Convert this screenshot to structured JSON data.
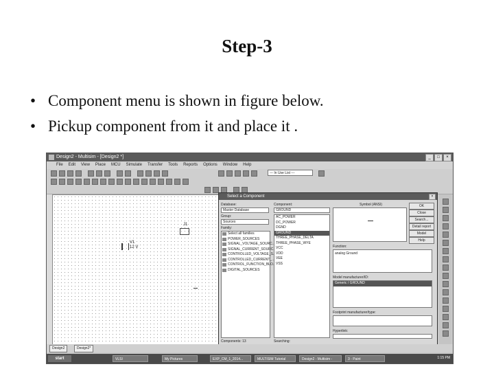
{
  "slide": {
    "title": "Step-3",
    "bullets": [
      "Component menu is shown in figure below.",
      "Pickup component from it and place it ."
    ]
  },
  "app": {
    "window_title": "Design2 - Multisim - [Design2 *]",
    "menus": [
      "File",
      "Edit",
      "View",
      "Place",
      "MCU",
      "Simulate",
      "Transfer",
      "Tools",
      "Reports",
      "Options",
      "Window",
      "Help"
    ],
    "in_use_list": "--- In Use List ---",
    "components": {
      "v1_name": "V1",
      "v1_value": "12 V",
      "j1_name": "J1"
    },
    "tabs": [
      "Design2",
      "Design2*"
    ]
  },
  "dialog": {
    "title": "Select a Component",
    "database_label": "Database:",
    "database_value": "Master Database",
    "group_label": "Group:",
    "group_value": "Sources",
    "family_label": "Family:",
    "families": [
      "Select all families",
      "POWER_SOURCES",
      "SIGNAL_VOLTAGE_SOURC...",
      "SIGNAL_CURRENT_SOURC...",
      "CONTROLLED_VOLTAGE_S...",
      "CONTROLLED_CURRENT_...",
      "CONTROL_FUNCTION_BLO...",
      "DIGITAL_SOURCES"
    ],
    "component_label": "Component:",
    "component_value": "GROUND",
    "component_list": [
      "AC_POWER",
      "DC_POWER",
      "DGND",
      "GROUND",
      "THREE_PHASE_DELTA",
      "THREE_PHASE_WYE",
      "VCC",
      "VDD",
      "VEE",
      "VSS"
    ],
    "selected_component": "GROUND",
    "symbol_label": "Symbol (ANSI)",
    "function_label": "Function:",
    "function_value": "analog Ground",
    "model_manufacturer_label": "Model manufacturer/ID:",
    "model_manufacturer_value": "Generic / GROUND",
    "footprint_label": "Footprint manufacturer/type:",
    "hyperlink_label": "Hyperlink:",
    "components_count_label": "Components: 13",
    "searching_label": "Searching:",
    "buttons": [
      "OK",
      "Close",
      "Search...",
      "Detail report",
      "Model",
      "Help"
    ]
  },
  "taskbar": {
    "start": "start",
    "tasks": [
      "VLSI",
      "My Pictures",
      "EXP_CM_1_2014...",
      "MULTISIM Tutorial",
      "Design2 - Multisim -",
      "3 - Paint"
    ],
    "clock": "1:15 PM"
  }
}
